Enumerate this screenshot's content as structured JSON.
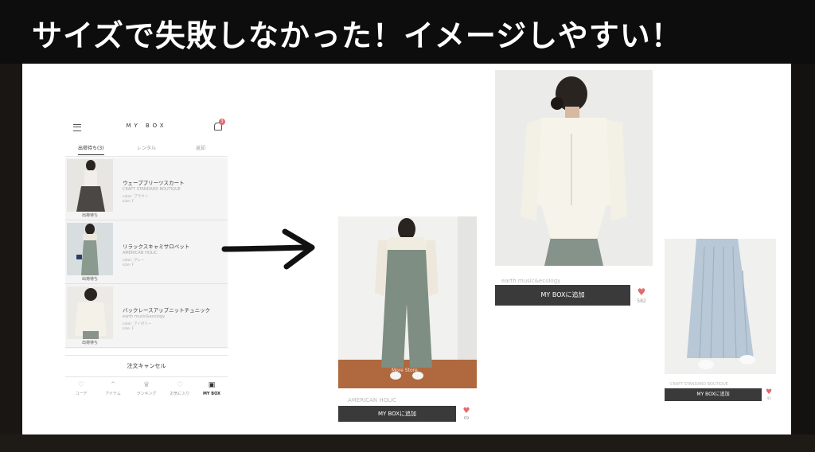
{
  "banner": {
    "title": "サイズで失敗しなかった！イメージしやすい！"
  },
  "phone": {
    "title": "MY BOX",
    "badge": "3",
    "tabs": [
      "出荷待ち(3)",
      "レンタル",
      "返却"
    ],
    "items": [
      {
        "name": "ウェーブプリーツスカート",
        "brand": "CRAFT STANDARD BOUTIQUE",
        "color": "color: ブラウン",
        "size": "size: F",
        "status": "出荷待ち"
      },
      {
        "name": "リラックスキャミサロペット",
        "brand": "AMERICAN HOLIC",
        "color": "color: グレー",
        "size": "size: F",
        "status": "出荷待ち"
      },
      {
        "name": "バックレースアップニットチュニック",
        "brand": "earth music&ecology",
        "color": "color: アイボリー",
        "size": "size: F",
        "status": "出荷待ち"
      }
    ],
    "cancel_label": "注文キャンセル",
    "nav": [
      {
        "icon": "heart-icon",
        "label": "コーデ"
      },
      {
        "icon": "hanger-icon",
        "label": "アイテム"
      },
      {
        "icon": "ranking-icon",
        "label": "ランキング"
      },
      {
        "icon": "favorite-icon",
        "label": "お気に入り"
      },
      {
        "icon": "box-icon",
        "label": "MY BOX"
      }
    ]
  },
  "cards": [
    {
      "overlay": "More Store",
      "caption": "AMERICAN HOLIC",
      "button": "MY BOXに追加",
      "count": "69"
    },
    {
      "overlay": "",
      "caption": "earth music&ecology",
      "button": "MY BOXに追加",
      "count": "582"
    },
    {
      "overlay": "",
      "caption": "CRAFT STANDARD BOUTIQUE",
      "button": "MY BOXに追加",
      "count": "43"
    }
  ],
  "colors": {
    "accent": "#e36b6b",
    "button": "#3a3a3a",
    "banner": "#0d0d0d"
  }
}
